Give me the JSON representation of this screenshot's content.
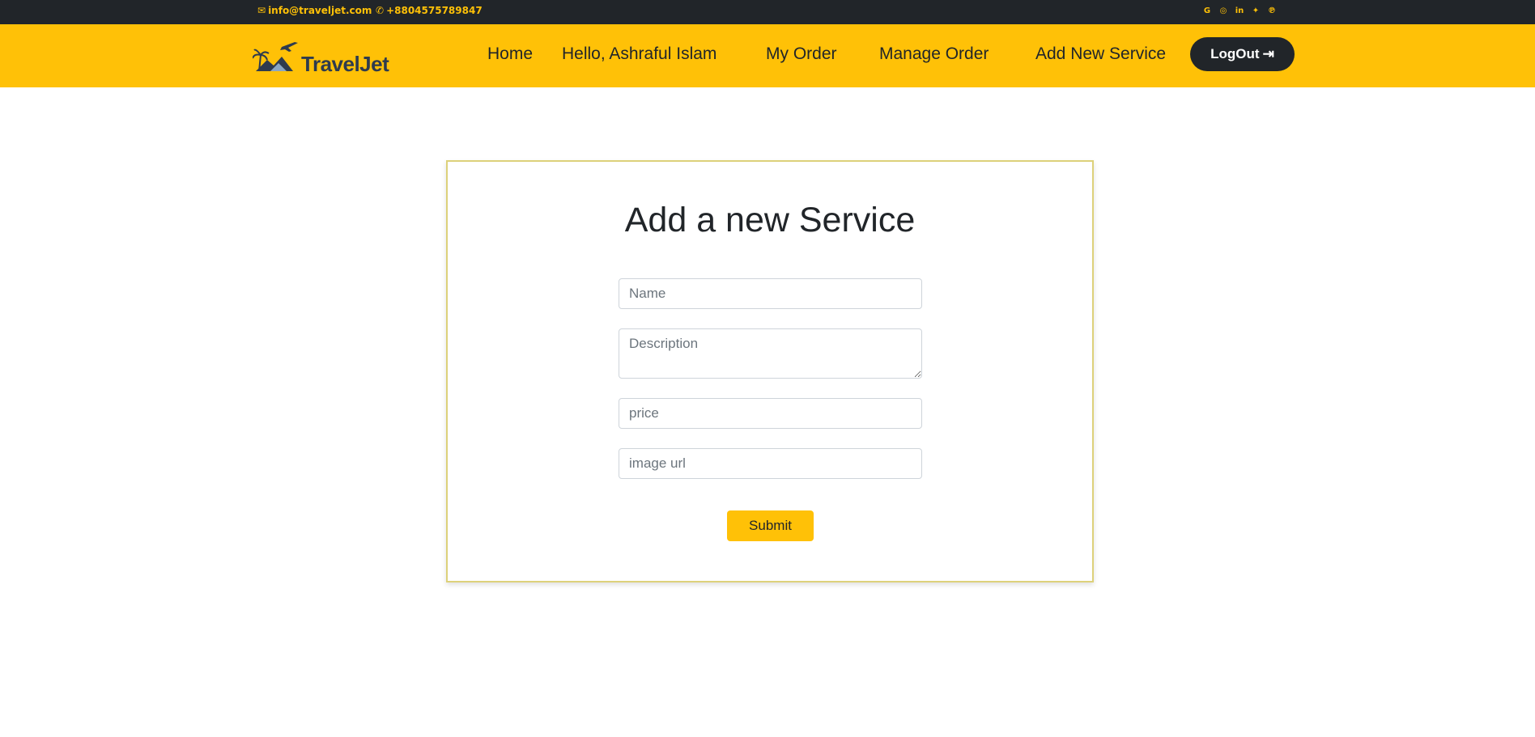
{
  "topbar": {
    "email": "info@traveljet.com",
    "phone": "+8804575789847",
    "socials": [
      {
        "icon": "google-icon",
        "glyph": "G"
      },
      {
        "icon": "instagram-icon",
        "glyph": "◎"
      },
      {
        "icon": "linkedin-icon",
        "glyph": "in"
      },
      {
        "icon": "twitter-icon",
        "glyph": "✦"
      },
      {
        "icon": "pinterest-icon",
        "glyph": "℗"
      }
    ]
  },
  "navbar": {
    "logo_text": "TravelJet",
    "links": {
      "home": "Home",
      "hello": "Hello, Ashraful Islam",
      "my_order": "My Order",
      "manage_order": "Manage Order",
      "add_service": "Add New Service"
    },
    "logout_label": "LogOut"
  },
  "form": {
    "title": "Add a new Service",
    "name_placeholder": "Name",
    "description_placeholder": "Description",
    "price_placeholder": "price",
    "image_placeholder": "image url",
    "submit_label": "Submit"
  },
  "colors": {
    "accent": "#ffc107",
    "dark": "#212529",
    "card_border": "#ddd17a"
  }
}
